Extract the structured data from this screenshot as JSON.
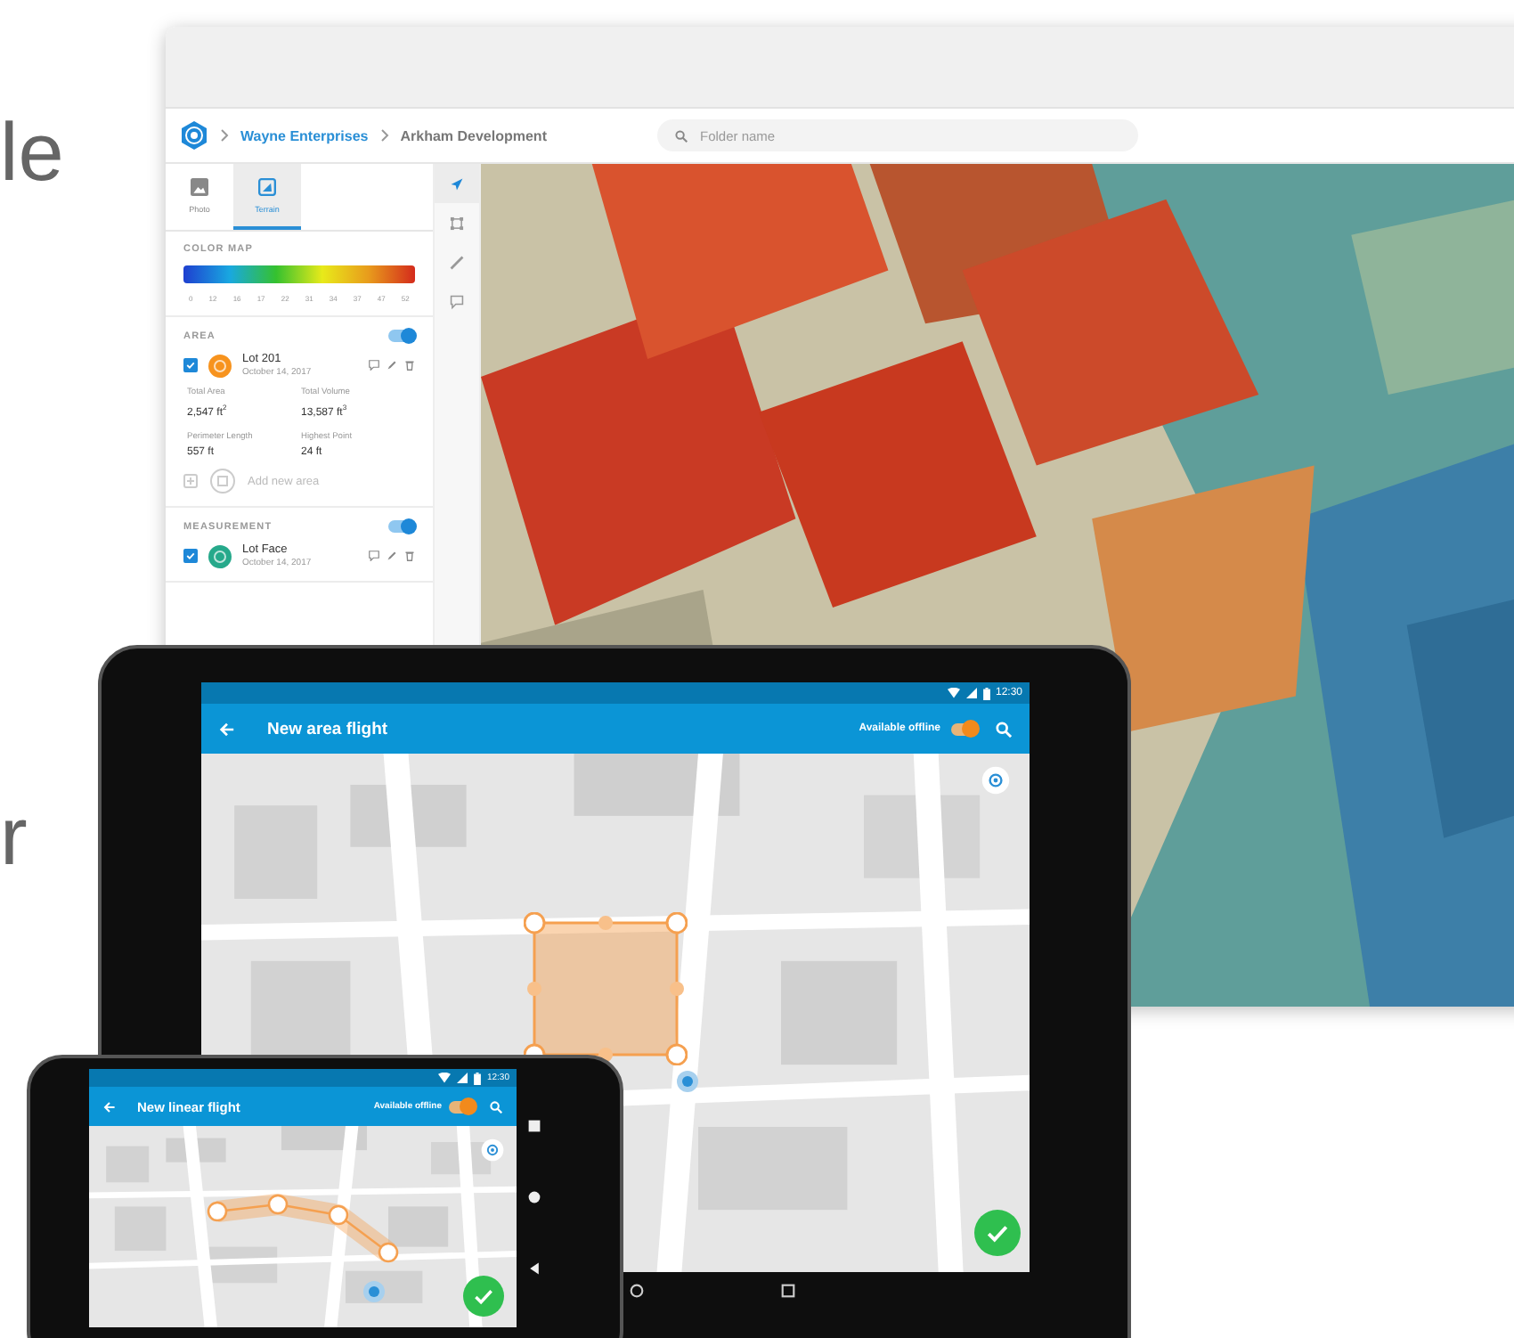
{
  "side_text": [
    {
      "text": "le"
    },
    {
      "text": "r"
    }
  ],
  "browser": {
    "breadcrumb": [
      "Wayne Enterprises",
      "Arkham Development"
    ],
    "search": {
      "placeholder": "Folder name"
    },
    "tabs": [
      {
        "label": "Photo",
        "selected": false
      },
      {
        "label": "Terrain",
        "kind": "terrain",
        "selected": true
      }
    ],
    "color_map": {
      "title": "COLOR MAP",
      "ticks": [
        "0",
        "12",
        "16",
        "17",
        "22",
        "31",
        "34",
        "37",
        "47",
        "52"
      ]
    },
    "sections": [
      {
        "title": "AREA",
        "on": true,
        "items": [
          {
            "name": "Lot 201",
            "date": "October 14, 2017",
            "checked": true,
            "color": "#f7931e",
            "stats": [
              {
                "label": "Total Area",
                "value": "2,547 ft$^{2}$"
              },
              {
                "label": "Total Volume",
                "value": "13,587 ft$^{3}$"
              },
              {
                "label": "Perimeter Length",
                "value": "557 ft"
              },
              {
                "label": "Highest Point",
                "value": "24 ft"
              }
            ]
          }
        ],
        "add_label": "Add new area"
      },
      {
        "title": "MEASUREMENT",
        "on": true,
        "items": [
          {
            "name": "Lot Face",
            "date": "October 14, 2017",
            "checked": true,
            "color": "#26a98b"
          }
        ]
      }
    ],
    "tools": [
      {
        "kind": "navigate",
        "selected": true
      },
      {
        "kind": "select",
        "selected": false
      },
      {
        "kind": "ruler",
        "selected": false
      },
      {
        "kind": "comment",
        "selected": false
      }
    ]
  },
  "tablet": {
    "status_time": "12:30",
    "title": "New area flight",
    "offline_label": "Available offline",
    "offline_on": true
  },
  "phone": {
    "status_time": "12:30",
    "title": "New linear flight",
    "offline_label": "Available offline",
    "offline_on": true
  }
}
